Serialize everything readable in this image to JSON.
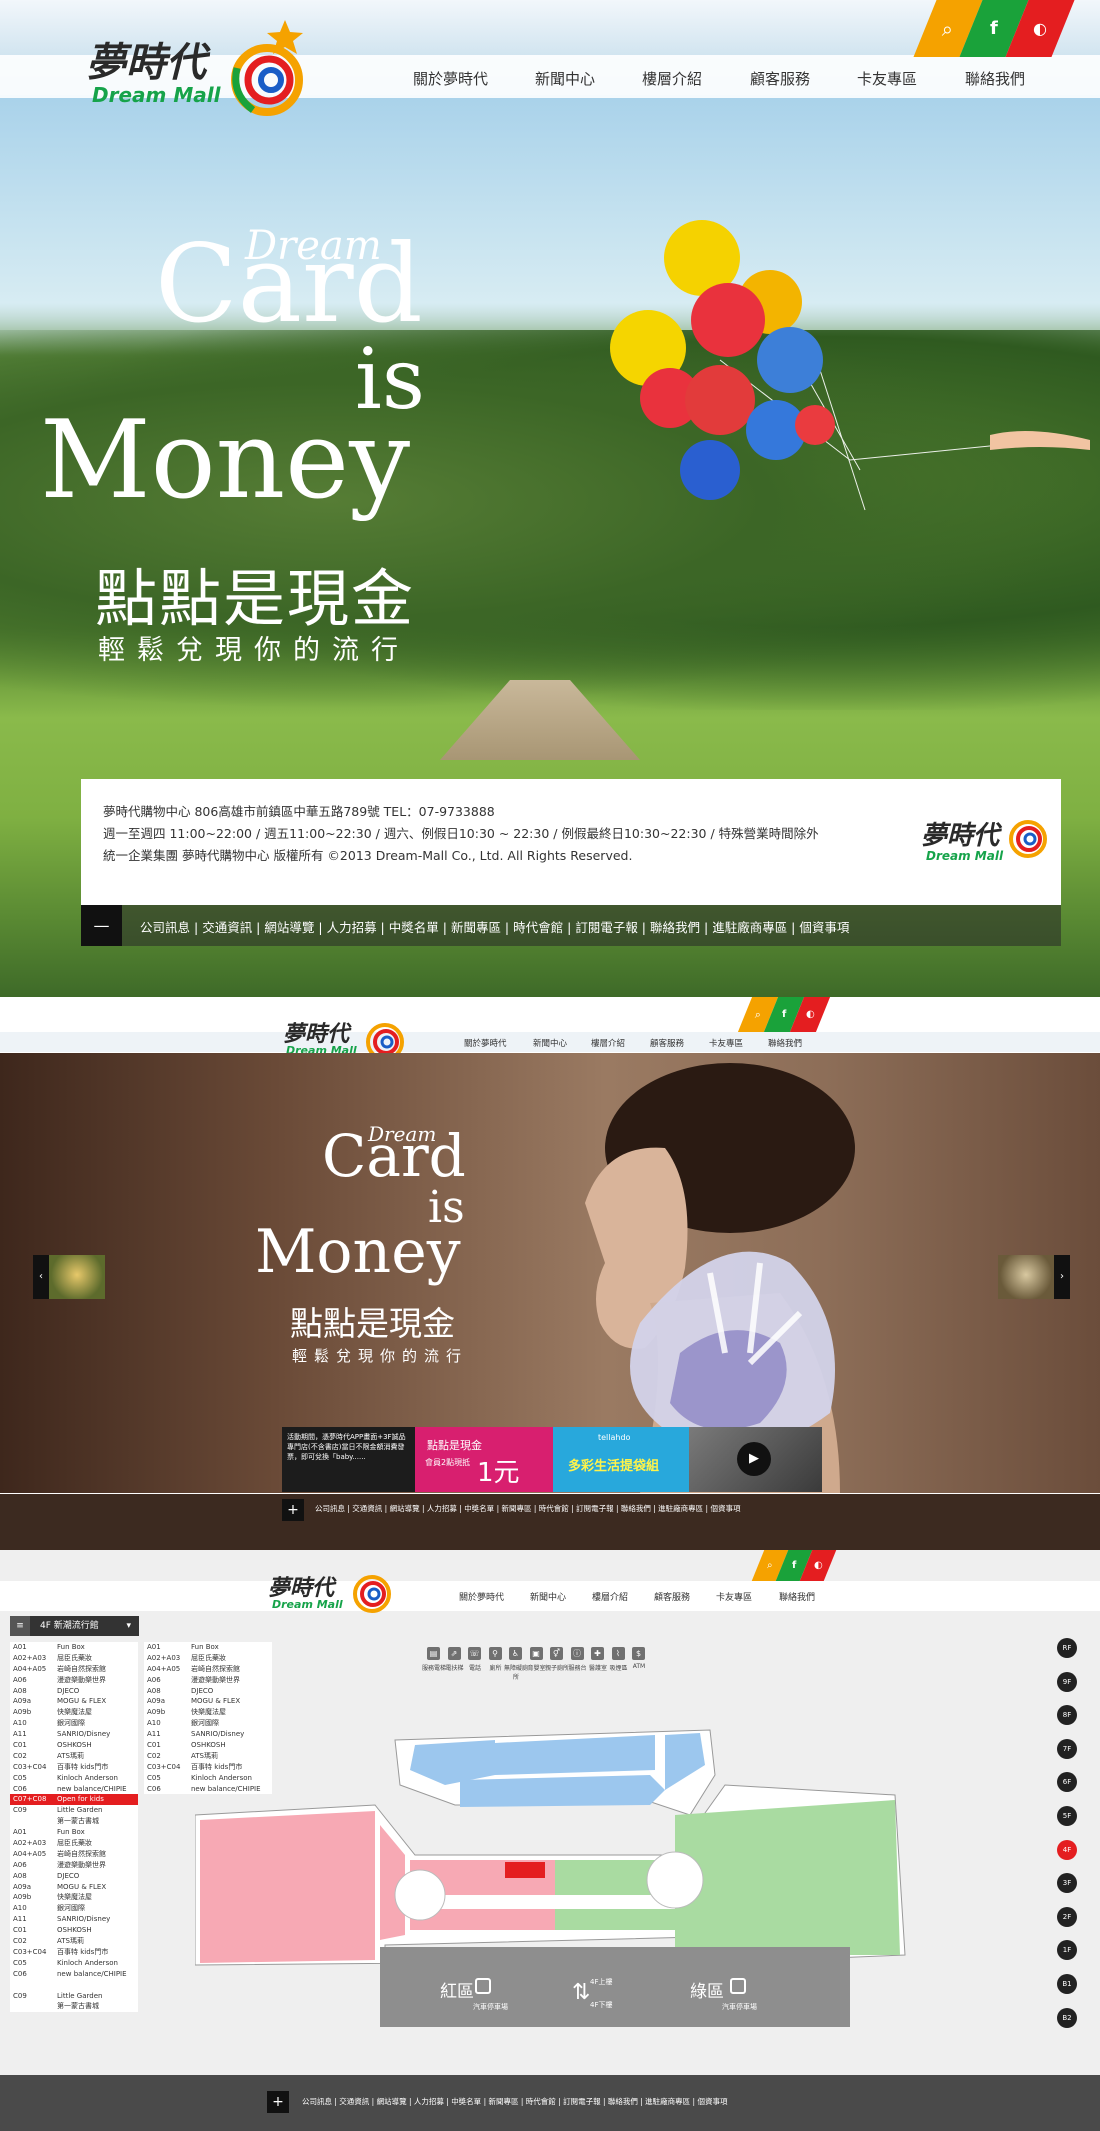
{
  "brand": {
    "name_zh": "夢時代",
    "name_en": "Dream Mall"
  },
  "nav": [
    "關於夢時代",
    "新聞中心",
    "樓層介紹",
    "顧客服務",
    "卡友專區",
    "聯絡我們"
  ],
  "social": [
    {
      "icon": "search-icon",
      "glyph": "⌕",
      "color": "#f5a200"
    },
    {
      "icon": "facebook-icon",
      "glyph": "f",
      "color": "#1aa23a"
    },
    {
      "icon": "globe-icon",
      "glyph": "◐",
      "color": "#e41e20"
    }
  ],
  "hero": {
    "dream": "Dream",
    "card": "Card",
    "is": "is",
    "money": "Money",
    "zh_title": "點點是現金",
    "zh_sub": "輕鬆兌現你的流行"
  },
  "info": {
    "line1": "夢時代購物中心  806高雄市前鎮區中華五路789號  TEL：07-9733888",
    "line2": "週一至週四 11:00~22:00 / 週五11:00~22:30 / 週六、例假日10:30 ~ 22:30 / 例假最終日10:30~22:30 / 特殊營業時間除外",
    "line3": "統一企業集團 夢時代購物中心 版權所有 ©2013 Dream-Mall Co., Ltd. All Rights Reserved."
  },
  "footer_toggle_minus": "—",
  "footer_toggle_plus": "+",
  "footer_links": [
    "公司訊息",
    "交通資訊",
    "網站導覽",
    "人力招募",
    "中獎名單",
    "新聞專區",
    "時代會館",
    "訂閱電子報",
    "聯絡我們",
    "進駐廠商專區",
    "個資事項"
  ],
  "banners": {
    "b1": "活動期間，憑夢時代APP畫面+3F誠品專門店(不含書店)當日不限金額消費發票，即可兌換「baby......",
    "b2_title": "點點是現金",
    "b2_sub": "會員2點現抵",
    "b2_value": "1元",
    "b3_brand": "tellahdo",
    "b3_title": "多彩生活提袋組",
    "b4_play": "▶"
  },
  "floor": {
    "dropdown": "4F 新潮流行館",
    "legend_left": [
      [
        "A01",
        "Fun Box"
      ],
      [
        "A02+A03",
        "屈臣氏藥妝"
      ],
      [
        "A04+A05",
        "岩崎自然探索館"
      ],
      [
        "A06",
        "漫遊樂動樂世界"
      ],
      [
        "A08",
        "DJECO"
      ],
      [
        "A09a",
        "MOGU & FLEX"
      ],
      [
        "A09b",
        "快樂魔法屋"
      ],
      [
        "A10",
        "銀河國際"
      ],
      [
        "A11",
        "SANRIO/Disney"
      ],
      [
        "C01",
        "OSHKOSH"
      ],
      [
        "C02",
        "ATS瑪莉"
      ],
      [
        "C03+C04",
        "百事特 kids門市"
      ],
      [
        "C05",
        "Kinloch Anderson"
      ],
      [
        "C06",
        "new balance/CHIPIE"
      ],
      [
        "C07+C08",
        "Open for kids"
      ],
      [
        "C09",
        "Little Garden"
      ],
      [
        "",
        "第一蒙古書城"
      ],
      [
        "A01",
        "Fun Box"
      ],
      [
        "A02+A03",
        "屈臣氏藥妝"
      ],
      [
        "A04+A05",
        "岩崎自然探索館"
      ],
      [
        "A06",
        "漫遊樂動樂世界"
      ],
      [
        "A08",
        "DJECO"
      ],
      [
        "A09a",
        "MOGU & FLEX"
      ],
      [
        "A09b",
        "快樂魔法屋"
      ],
      [
        "A10",
        "銀河國際"
      ],
      [
        "A11",
        "SANRIO/Disney"
      ],
      [
        "C01",
        "OSHKOSH"
      ],
      [
        "C02",
        "ATS瑪莉"
      ],
      [
        "C03+C04",
        "百事特 kids門市"
      ],
      [
        "C05",
        "Kinloch Anderson"
      ],
      [
        "C06",
        "new balance/CHIPIE"
      ],
      [
        "",
        ""
      ],
      [
        "C09",
        "Little Garden"
      ],
      [
        "",
        "第一蒙古書城"
      ]
    ],
    "legend_right": [
      [
        "A01",
        "Fun Box"
      ],
      [
        "A02+A03",
        "屈臣氏藥妝"
      ],
      [
        "A04+A05",
        "岩崎自然探索館"
      ],
      [
        "A06",
        "漫遊樂動樂世界"
      ],
      [
        "A08",
        "DJECO"
      ],
      [
        "A09a",
        "MOGU & FLEX"
      ],
      [
        "A09b",
        "快樂魔法屋"
      ],
      [
        "A10",
        "銀河國際"
      ],
      [
        "A11",
        "SANRIO/Disney"
      ],
      [
        "C01",
        "OSHKOSH"
      ],
      [
        "C02",
        "ATS瑪莉"
      ],
      [
        "C03+C04",
        "百事特 kids門市"
      ],
      [
        "C05",
        "Kinloch Anderson"
      ],
      [
        "C06",
        "new balance/CHIPIE"
      ]
    ],
    "highlight_code": "C07+C08",
    "facilities": [
      {
        "icon": "service-desk-icon",
        "label": "服務電梯"
      },
      {
        "icon": "escalator-icon",
        "label": "電扶梯"
      },
      {
        "icon": "phone-icon",
        "label": "電話"
      },
      {
        "icon": "restroom-icon",
        "label": "廁所"
      },
      {
        "icon": "accessible-restroom-icon",
        "label": "無障礙廁所"
      },
      {
        "icon": "baby-room-icon",
        "label": "育嬰室"
      },
      {
        "icon": "family-restroom-icon",
        "label": "親子廁所"
      },
      {
        "icon": "info-desk-icon",
        "label": "服務台"
      },
      {
        "icon": "first-aid-icon",
        "label": "醫護室"
      },
      {
        "icon": "lockers-icon",
        "label": "吸煙區"
      },
      {
        "icon": "atm-icon",
        "label": "ATM"
      }
    ],
    "floors": [
      "RF",
      "9F",
      "8F",
      "7F",
      "6F",
      "5F",
      "4F",
      "3F",
      "2F",
      "1F",
      "B1",
      "B2"
    ],
    "active_floor": "4F",
    "parking_red": "紅區",
    "parking_green": "綠區",
    "parking_sub": "汽車停車場",
    "up_label": "4F上樓",
    "down_label": "4F下樓"
  },
  "colors": {
    "red": "#e41e20",
    "green": "#1aa23a",
    "orange": "#f5a200",
    "pink_zone": "#f7a9b4",
    "green_zone": "#a9dba1",
    "blue_zone": "#9cc7ee"
  }
}
